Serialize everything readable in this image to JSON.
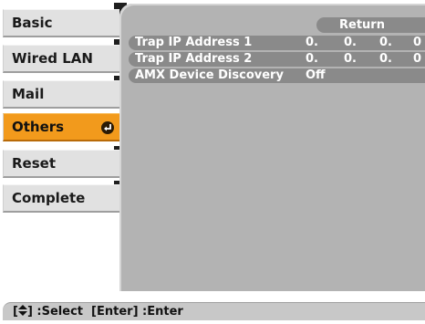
{
  "sidebar": {
    "items": [
      {
        "label": "Basic",
        "selected": false
      },
      {
        "label": "Wired LAN",
        "selected": false
      },
      {
        "label": "Mail",
        "selected": false
      },
      {
        "label": "Others",
        "selected": true,
        "icon": "enter-icon"
      },
      {
        "label": "Reset",
        "selected": false
      },
      {
        "label": "Complete",
        "selected": false
      }
    ]
  },
  "panel": {
    "return_label": "Return",
    "rows": [
      {
        "label": "Trap IP Address 1",
        "octets": [
          "0.",
          "0.",
          "0.",
          "0"
        ]
      },
      {
        "label": "Trap IP Address 2",
        "octets": [
          "0.",
          "0.",
          "0.",
          "0"
        ]
      },
      {
        "label": "AMX Device Discovery",
        "value": "Off"
      }
    ]
  },
  "status_bar": {
    "select_icon": "up-down-arrow-icon",
    "select_text_left": "[",
    "select_text_right": "] :Select  [Enter] :Enter"
  },
  "colors": {
    "highlight": "#f29a1c",
    "panel_bg": "#b3b3b3",
    "row_bg": "#8a8a8a",
    "menu_bg": "#e1e1e1"
  }
}
